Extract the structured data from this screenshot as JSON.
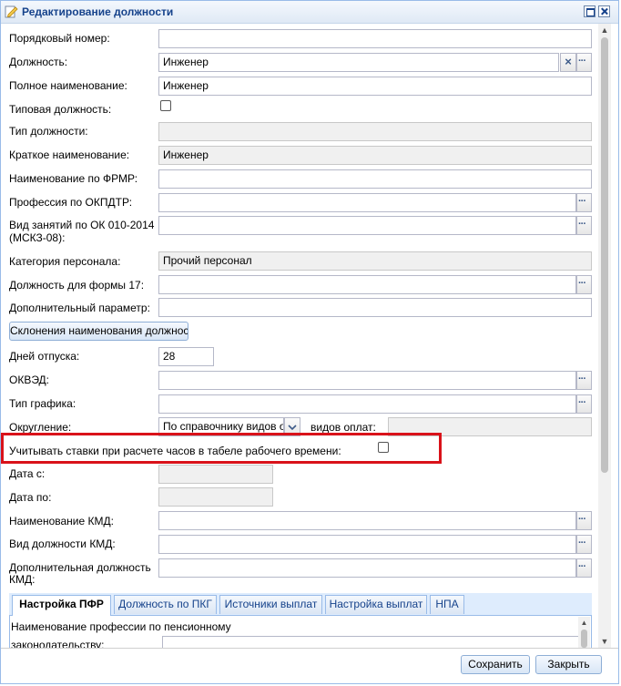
{
  "window": {
    "title": "Редактирование должности"
  },
  "fields": {
    "order_number": {
      "label": "Порядковый номер:",
      "value": ""
    },
    "position": {
      "label": "Должность:",
      "value": "Инженер"
    },
    "full_name": {
      "label": "Полное наименование:",
      "value": "Инженер"
    },
    "typical": {
      "label": "Типовая должность:"
    },
    "position_type": {
      "label": "Тип должности:",
      "value": ""
    },
    "short_name": {
      "label": "Краткое наименование:",
      "value": "Инженер"
    },
    "frmr_name": {
      "label": "Наименование по ФРМР:",
      "value": ""
    },
    "okpdtr": {
      "label": "Профессия по ОКПДТР:",
      "value": ""
    },
    "ok010_line1": {
      "label": "Вид занятий по ОК 010-2014"
    },
    "ok010_line2": {
      "label": "(МСКЗ-08):",
      "value": ""
    },
    "staff_category": {
      "label": "Категория персонала:",
      "value": "Прочий персонал"
    },
    "form17": {
      "label": "Должность для формы 17:",
      "value": ""
    },
    "extra_param": {
      "label": "Дополнительный параметр:",
      "value": ""
    },
    "vacation_days": {
      "label": "Дней отпуска:",
      "value": "28"
    },
    "okved": {
      "label": "ОКВЭД:",
      "value": ""
    },
    "schedule_type": {
      "label": "Тип графика:",
      "value": ""
    },
    "rounding": {
      "label": "Округление:",
      "value": "По справочнику видов о"
    },
    "payment_types": {
      "label": "видов оплат:",
      "value": ""
    },
    "consider_rates": {
      "label": "Учитывать ставки при расчете часов в табеле рабочего времени:"
    },
    "date_from": {
      "label": "Дата с:",
      "value": ""
    },
    "date_to": {
      "label": "Дата по:",
      "value": ""
    },
    "kmd_name": {
      "label": "Наименование КМД:",
      "value": ""
    },
    "kmd_type": {
      "label": "Вид должности КМД:",
      "value": ""
    },
    "kmd_extra_line1": {
      "label": "Дополнительная должность"
    },
    "kmd_extra_line2": {
      "label": "КМД:",
      "value": ""
    }
  },
  "buttons": {
    "declensions": "Склонения наименования должности",
    "save": "Сохранить",
    "close": "Закрыть"
  },
  "tabs": [
    {
      "label": "Настройка ПФР"
    },
    {
      "label": "Должность по ПКГ"
    },
    {
      "label": "Источники выплат"
    },
    {
      "label": "Настройка выплат"
    },
    {
      "label": "НПА"
    }
  ],
  "tab_content": {
    "pension_line1": "Наименование профессии по пенсионному",
    "pension_line2": "законодательству:"
  },
  "colors": {
    "highlight": "#d9121a",
    "title": "#15428b"
  }
}
